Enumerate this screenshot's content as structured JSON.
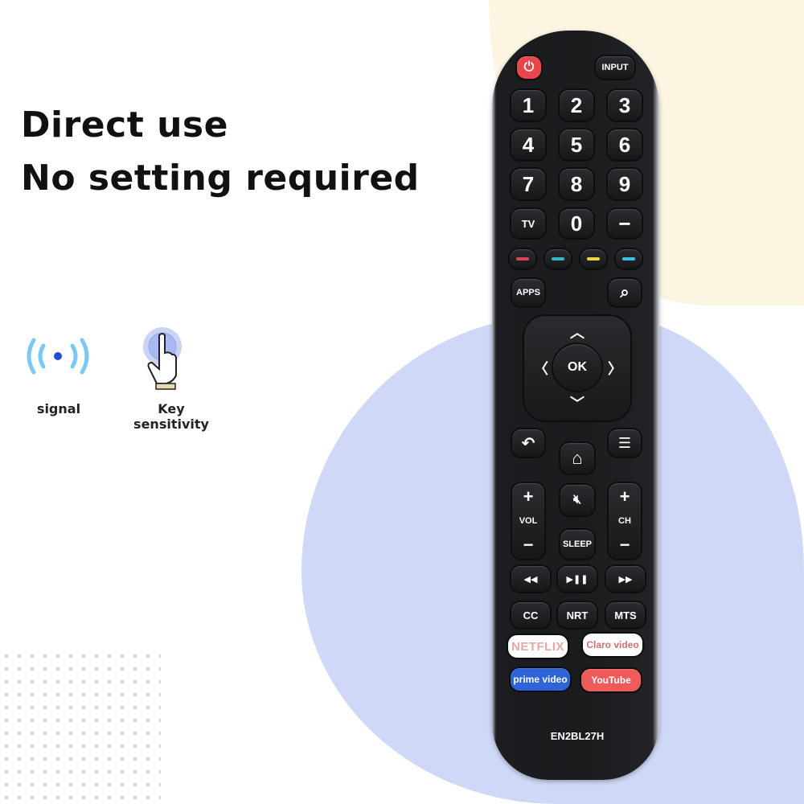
{
  "headline": {
    "line1": "Direct use",
    "line2": "No setting required"
  },
  "features": [
    {
      "label": "signal",
      "icon": "signal-icon"
    },
    {
      "label": "Key sensitivity",
      "icon": "touch-finger-icon"
    }
  ],
  "remote": {
    "model": "EN2BL27H",
    "top": {
      "power": "⏻",
      "input": "INPUT"
    },
    "digits": [
      "1",
      "2",
      "3",
      "4",
      "5",
      "6",
      "7",
      "8",
      "9"
    ],
    "row4": [
      "TV",
      "0",
      "−"
    ],
    "color_keys": [
      "#d6464a",
      "#33b6c4",
      "#e6d640",
      "#3cc0e0"
    ],
    "apps": "APPS",
    "ok": "OK",
    "vol": {
      "plus": "+",
      "label": "VOL",
      "minus": "−"
    },
    "ch": {
      "plus": "+",
      "label": "CH",
      "minus": "−"
    },
    "sleep": "SLEEP",
    "transport": [
      "◀◀",
      "▶❚❚",
      "▶▶"
    ],
    "func": [
      "CC",
      "NRT",
      "MTS"
    ],
    "apps_keys": [
      {
        "label": "NETFLIX",
        "bg": "#ffffff",
        "color": "#e8a6a8"
      },
      {
        "label": "Claro video",
        "bg": "#ffffff",
        "color": "#d07070"
      },
      {
        "label": "prime video",
        "bg": "#2f63d8",
        "color": "#ffffff"
      },
      {
        "label": "YouTube",
        "bg": "#ef5b5b",
        "color": "#ffffff"
      }
    ]
  },
  "colors": {
    "beige_circle": "#fcf5e1",
    "blue_circle": "#cfd8f6",
    "signal": "#7cc8f5",
    "signal_dot": "#1f4fd6"
  }
}
